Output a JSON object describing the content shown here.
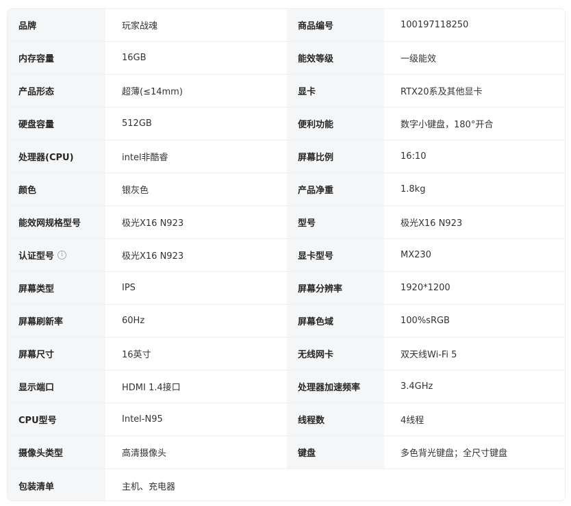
{
  "specs": {
    "rows": [
      {
        "l1": "品牌",
        "v1": "玩家战魂",
        "l2": "商品编号",
        "v2": "100197118250"
      },
      {
        "l1": "内存容量",
        "v1": "16GB",
        "l2": "能效等级",
        "v2": "一级能效"
      },
      {
        "l1": "产品形态",
        "v1": "超薄(≤14mm)",
        "l2": "显卡",
        "v2": "RTX20系及其他显卡"
      },
      {
        "l1": "硬盘容量",
        "v1": "512GB",
        "l2": "便利功能",
        "v2": "数字小键盘，180°开合"
      },
      {
        "l1": "处理器(CPU)",
        "v1": "intel非酷睿",
        "l2": "屏幕比例",
        "v2": "16:10"
      },
      {
        "l1": "颜色",
        "v1": "银灰色",
        "l2": "产品净重",
        "v2": "1.8kg"
      },
      {
        "l1": "能效网规格型号",
        "v1": "极光X16 N923",
        "l2": "型号",
        "v2": "极光X16 N923"
      },
      {
        "l1": "认证型号",
        "v1": "极光X16 N923",
        "l2": "显卡型号",
        "v2": "MX230"
      },
      {
        "l1": "屏幕类型",
        "v1": "IPS",
        "l2": "屏幕分辨率",
        "v2": "1920*1200"
      },
      {
        "l1": "屏幕刷新率",
        "v1": "60Hz",
        "l2": "屏幕色域",
        "v2": "100%sRGB"
      },
      {
        "l1": "屏幕尺寸",
        "v1": "16英寸",
        "l2": "无线网卡",
        "v2": "双天线Wi-Fi 5"
      },
      {
        "l1": "显示端口",
        "v1": "HDMI 1.4接口",
        "l2": "处理器加速频率",
        "v2": "3.4GHz"
      },
      {
        "l1": "CPU型号",
        "v1": "Intel-N95",
        "l2": "线程数",
        "v2": "4线程"
      },
      {
        "l1": "摄像头类型",
        "v1": "高清摄像头",
        "l2": "键盘",
        "v2": "多色背光键盘；全尺寸键盘"
      }
    ],
    "last_row": {
      "l1": "包装清单",
      "v1": "主机、充电器"
    },
    "info_icon_glyph": "i"
  },
  "colors": {
    "label_bg": "#f5f6f7",
    "border": "#f0f0f0",
    "text": "#333333"
  }
}
